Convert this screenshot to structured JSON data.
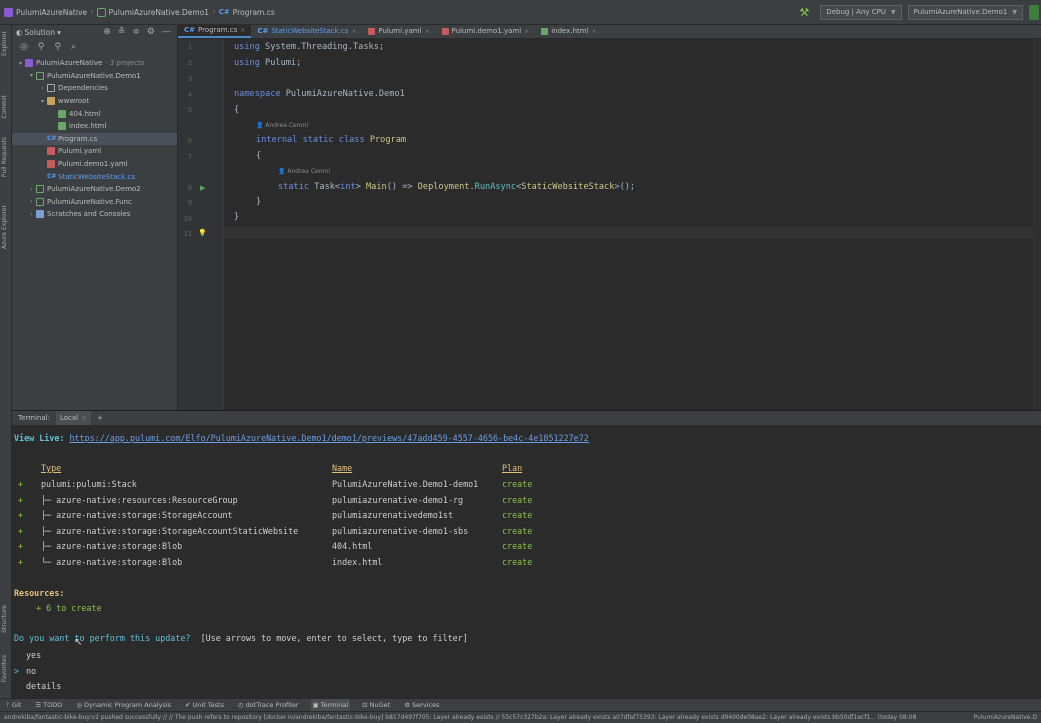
{
  "breadcrumb": {
    "solution": "PulumiAzureNative",
    "project": "PulumiAzureNative.Demo1",
    "file": "Program.cs"
  },
  "toolbar": {
    "config": "Debug | Any CPU",
    "run_target": "PulumiAzureNative.Demo1"
  },
  "left_strip": [
    "Explorer",
    "Commit",
    "Pull Requests",
    "Azure Explorer",
    "Structure",
    "Favorites"
  ],
  "project_panel": {
    "view_selector": "Solution",
    "tree": [
      {
        "label": "PulumiAzureNative",
        "extra": "· 3 projects",
        "indent": 0,
        "arrow": "▾",
        "icon": "sln"
      },
      {
        "label": "PulumiAzureNative.Demo1",
        "indent": 1,
        "arrow": "▾",
        "icon": "proj"
      },
      {
        "label": "Dependencies",
        "indent": 2,
        "arrow": "›",
        "icon": "dep"
      },
      {
        "label": "wwwroot",
        "indent": 2,
        "arrow": "▾",
        "icon": "folder"
      },
      {
        "label": "404.html",
        "indent": 3,
        "arrow": "",
        "icon": "html"
      },
      {
        "label": "index.html",
        "indent": 3,
        "arrow": "",
        "icon": "html"
      },
      {
        "label": "Program.cs",
        "indent": 2,
        "arrow": "",
        "icon": "cs",
        "selected": true
      },
      {
        "label": "Pulumi.yaml",
        "indent": 2,
        "arrow": "",
        "icon": "yaml"
      },
      {
        "label": "Pulumi.demo1.yaml",
        "indent": 2,
        "arrow": "",
        "icon": "yaml"
      },
      {
        "label": "StaticWebsiteStack.cs",
        "indent": 2,
        "arrow": "",
        "icon": "cs",
        "blue": true
      },
      {
        "label": "PulumiAzureNative.Demo2",
        "indent": 1,
        "arrow": "›",
        "icon": "proj"
      },
      {
        "label": "PulumiAzureNative.Func",
        "indent": 1,
        "arrow": "›",
        "icon": "proj"
      },
      {
        "label": "Scratches and Consoles",
        "indent": 1,
        "arrow": "›",
        "icon": "scratch"
      }
    ]
  },
  "editor": {
    "tabs": [
      {
        "label": "Program.cs",
        "badge": "C#",
        "active": true
      },
      {
        "label": "StaticWebsiteStack.cs",
        "badge": "C#",
        "blue": true
      },
      {
        "label": "Pulumi.yaml",
        "icon": "yaml"
      },
      {
        "label": "Pulumi.demo1.yaml",
        "icon": "yaml"
      },
      {
        "label": "index.html",
        "icon": "html"
      }
    ],
    "line_numbers": [
      "1",
      "2",
      "3",
      "4",
      "5",
      "6",
      "7",
      "8",
      "9",
      "10",
      "11"
    ],
    "author_hint": "Andrea Ceroni",
    "code": {
      "l1_kw": "using",
      "l1_rest": " System.Threading.Tasks;",
      "l2_kw": "using",
      "l2_rest": " Pulumi;",
      "l4_kw": "namespace",
      "l4_rest": " PulumiAzureNative.Demo1",
      "l5": "{",
      "l6_kw": "internal static class",
      "l6_cls": " Program",
      "l7": "{",
      "l8_kw": "static",
      "l8_a": " Task<",
      "l8_int": "int",
      "l8_b": "> ",
      "l8_main": "Main",
      "l8_c": "() => ",
      "l8_dep": "Deployment",
      "l8_d": ".",
      "l8_run": "RunAsync",
      "l8_e": "<",
      "l8_sws": "StaticWebsiteStack",
      "l8_f": ">();",
      "l9": "}",
      "l10": "}"
    }
  },
  "terminal": {
    "tab_label": "Terminal:",
    "tab_local": "Local",
    "view_live_label": "View Live:",
    "view_live_url": "https://app.pulumi.com/Elfo/PulumiAzureNative.Demo1/demo1/previews/47add459-4557-4656-be4c-4e1851227e72",
    "headers": {
      "type": "Type",
      "name": "Name",
      "plan": "Plan"
    },
    "rows": [
      {
        "sign": "+",
        "type": "pulumi:pulumi:Stack",
        "name": "PulumiAzureNative.Demo1-demo1",
        "plan": "create"
      },
      {
        "sign": "+",
        "type": "├─ azure-native:resources:ResourceGroup",
        "name": "pulumiazurenative-demo1-rg",
        "plan": "create"
      },
      {
        "sign": "+",
        "type": "├─ azure-native:storage:StorageAccount",
        "name": "pulumiazurenativedemo1st",
        "plan": "create"
      },
      {
        "sign": "+",
        "type": "├─ azure-native:storage:StorageAccountStaticWebsite",
        "name": "pulumiazurenative-demo1-sbs",
        "plan": "create"
      },
      {
        "sign": "+",
        "type": "├─ azure-native:storage:Blob",
        "name": "404.html",
        "plan": "create"
      },
      {
        "sign": "+",
        "type": "└─ azure-native:storage:Blob",
        "name": "index.html",
        "plan": "create"
      }
    ],
    "resources_label": "Resources:",
    "resources_summary": "+ 6 to create",
    "prompt_question": "Do you want to perform this update?",
    "prompt_hint": "[Use arrows to move, enter to select, type to filter]",
    "options": [
      {
        "marker": " ",
        "label": "yes"
      },
      {
        "marker": ">",
        "label": "no"
      },
      {
        "marker": " ",
        "label": "details"
      }
    ]
  },
  "tool_windows": [
    {
      "icon": "ᚠ",
      "label": "Git"
    },
    {
      "icon": "☰",
      "label": "TODO"
    },
    {
      "icon": "◎",
      "label": "Dynamic Program Analysis"
    },
    {
      "icon": "✔",
      "label": "Unit Tests"
    },
    {
      "icon": "◴",
      "label": "dotTrace Profiler"
    },
    {
      "icon": "▣",
      "label": "Terminal",
      "active": true
    },
    {
      "icon": "⊡",
      "label": "NuGet"
    },
    {
      "icon": "⚙",
      "label": "Services"
    }
  ],
  "status": {
    "message": "andrekiba/fantastic-bike-buy:v2 pushed successfully // // The push refers to repository [docker.io/andrekiba/fantastic-bike-buy] b817d497f705: Layer already exists // 55c57c327b2a: Layer already exists a07dfaf75393: Layer already exists d9400de08ae2: Layer already exists bb50df1ecf1... (today 08:08",
    "right": "PulumiAzureNative.D"
  }
}
